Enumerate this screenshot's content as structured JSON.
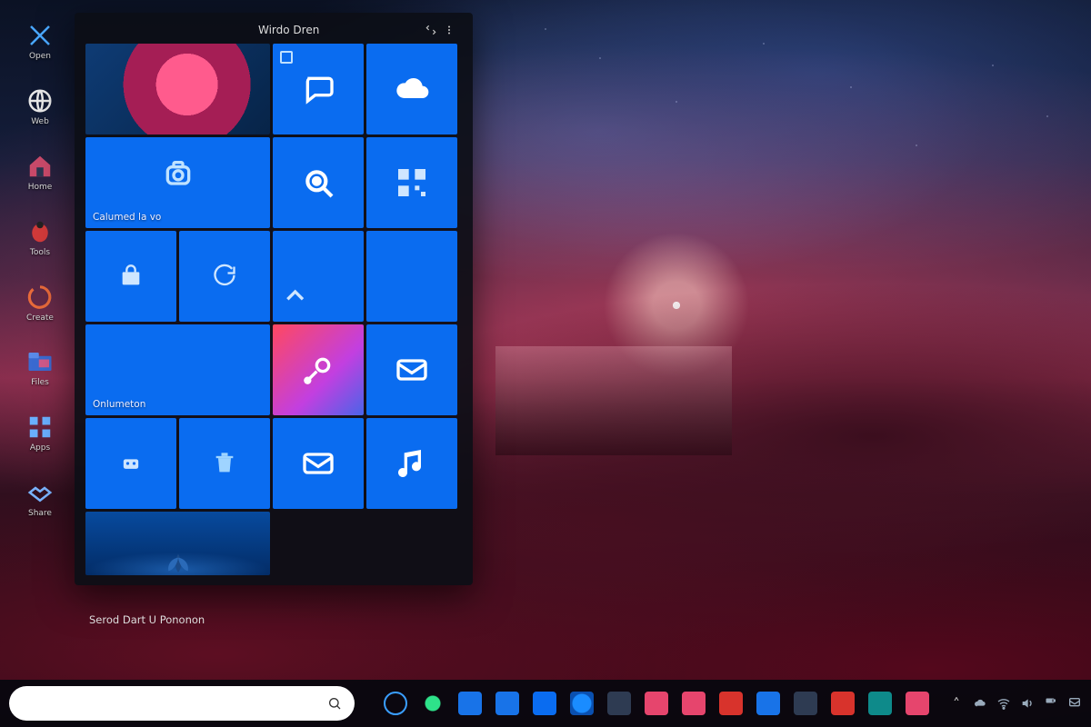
{
  "colors": {
    "tile_blue": "#0a6cf0",
    "accent_pink": "#ff4860",
    "panel_bg": "rgba(12,14,22,0.92)"
  },
  "desktop_icons": [
    {
      "name": "cross-tools-icon",
      "label": "Open"
    },
    {
      "name": "globe-icon",
      "label": "Web"
    },
    {
      "name": "house-icon",
      "label": "Home"
    },
    {
      "name": "ladybug-icon",
      "label": "Tools"
    },
    {
      "name": "swirl-icon",
      "label": "Create"
    },
    {
      "name": "folder-icon",
      "label": "Files"
    },
    {
      "name": "grid-icon",
      "label": "Apps"
    },
    {
      "name": "handshake-icon",
      "label": "Share"
    }
  ],
  "start_menu": {
    "header_title": "Wirdo Dren",
    "header_expand_label": "Expand",
    "header_more_label": "More",
    "footer_text": "Serod Dart U Pononon",
    "section_label_1": "Calumed la vo",
    "section_label_2": "Onlumeton",
    "tiles": [
      {
        "id": "photo",
        "name": "live-photo-tile",
        "icon": "flower-photo",
        "span": 2,
        "caption": ""
      },
      {
        "id": "chat",
        "name": "chat-tile",
        "icon": "chat-bubble",
        "span": 1,
        "caption": "",
        "mini": true
      },
      {
        "id": "cloud",
        "name": "cloud-tile",
        "icon": "cloud",
        "span": 1,
        "caption": ""
      },
      {
        "id": "camera",
        "name": "camera-tile",
        "icon": "camera",
        "span": 2,
        "caption_key": "section_label_1"
      },
      {
        "id": "target",
        "name": "search-target-tile",
        "icon": "target",
        "span": 1,
        "caption": ""
      },
      {
        "id": "qr",
        "name": "qr-share-tile",
        "icon": "qr",
        "span": 1,
        "caption": ""
      },
      {
        "id": "store",
        "name": "store-tile",
        "icon": "bag",
        "span": 1,
        "caption": ""
      },
      {
        "id": "refresh",
        "name": "refresh-tile",
        "icon": "refresh-arrow",
        "span": 1,
        "caption": ""
      },
      {
        "id": "corner1",
        "name": "corner-tile-1",
        "icon": "corner-caret",
        "span": 1,
        "caption": ""
      },
      {
        "id": "blank1",
        "name": "blank-tile-1",
        "icon": "",
        "span": 1,
        "caption": ""
      },
      {
        "id": "monitor",
        "name": "monitor-tile",
        "icon": "monitor",
        "span": 2,
        "caption_key": "section_label_2"
      },
      {
        "id": "social",
        "name": "social-tile",
        "icon": "spark-arrow",
        "span": 1,
        "caption": "",
        "variant": "gradient-pink"
      },
      {
        "id": "mail",
        "name": "mail-tile",
        "icon": "envelope",
        "span": 1,
        "caption": ""
      },
      {
        "id": "robot",
        "name": "assistant-tile",
        "icon": "robot-face",
        "span": 1,
        "caption": ""
      },
      {
        "id": "trash",
        "name": "recycle-tile",
        "icon": "trash",
        "span": 1,
        "caption": ""
      },
      {
        "id": "mail2",
        "name": "messages-tile",
        "icon": "envelope",
        "span": 1,
        "caption": ""
      },
      {
        "id": "music",
        "name": "music-tile",
        "icon": "music-note",
        "span": 1,
        "caption": ""
      },
      {
        "id": "plant",
        "name": "live-plant-tile",
        "icon": "plant",
        "span": 2,
        "caption": ""
      }
    ]
  },
  "taskbar": {
    "search_placeholder": "",
    "pinned": [
      {
        "name": "start-button",
        "icon": "ring"
      },
      {
        "name": "assistant-button",
        "icon": "dot-green"
      },
      {
        "name": "file-explorer",
        "icon": "sq-blue"
      },
      {
        "name": "store-app",
        "icon": "sq-blue"
      },
      {
        "name": "widgets-button",
        "icon": "sq-blue2"
      },
      {
        "name": "edge-browser",
        "icon": "ring-big"
      },
      {
        "name": "settings-app",
        "icon": "sq-slate"
      },
      {
        "name": "photos-app",
        "icon": "sq-pink"
      },
      {
        "name": "media-app",
        "icon": "sq-pink"
      },
      {
        "name": "security-app",
        "icon": "sq-red"
      },
      {
        "name": "mail-app",
        "icon": "sq-blue"
      },
      {
        "name": "terminal-app",
        "icon": "sq-slate"
      },
      {
        "name": "office-app",
        "icon": "sq-red"
      },
      {
        "name": "teams-app",
        "icon": "sq-teal"
      },
      {
        "name": "news-app",
        "icon": "sq-pink"
      }
    ],
    "tray": [
      {
        "name": "chevron-up-icon"
      },
      {
        "name": "onedrive-icon"
      },
      {
        "name": "wifi-icon"
      },
      {
        "name": "volume-icon"
      },
      {
        "name": "battery-icon"
      },
      {
        "name": "notification-icon"
      }
    ]
  }
}
